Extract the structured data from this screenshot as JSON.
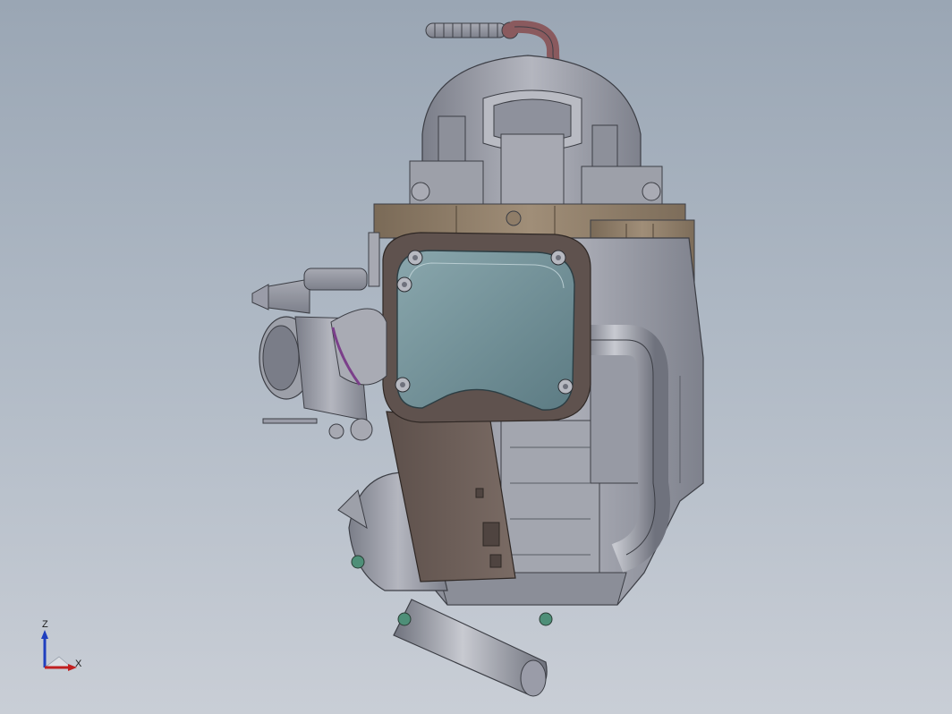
{
  "viewport": {
    "background_top": "#9aa6b4",
    "background_bottom": "#c9ced6"
  },
  "model": {
    "colors": {
      "metal": "#9a9ca8",
      "metal_dark": "#6e717c",
      "metal_light": "#c3c5cd",
      "bronze": "#8f7d68",
      "bronze_dark": "#6d5d4c",
      "brown_shroud": "#6c5e58",
      "glass": "#6f8f97",
      "hose_red": "#8a5a5e",
      "bolt_green": "#4e8f78"
    }
  },
  "triad": {
    "z_label": "Z",
    "x_label": "X",
    "z_color": "#1f3fbf",
    "x_color": "#c02020",
    "icon": "coordinate-triad-icon"
  }
}
